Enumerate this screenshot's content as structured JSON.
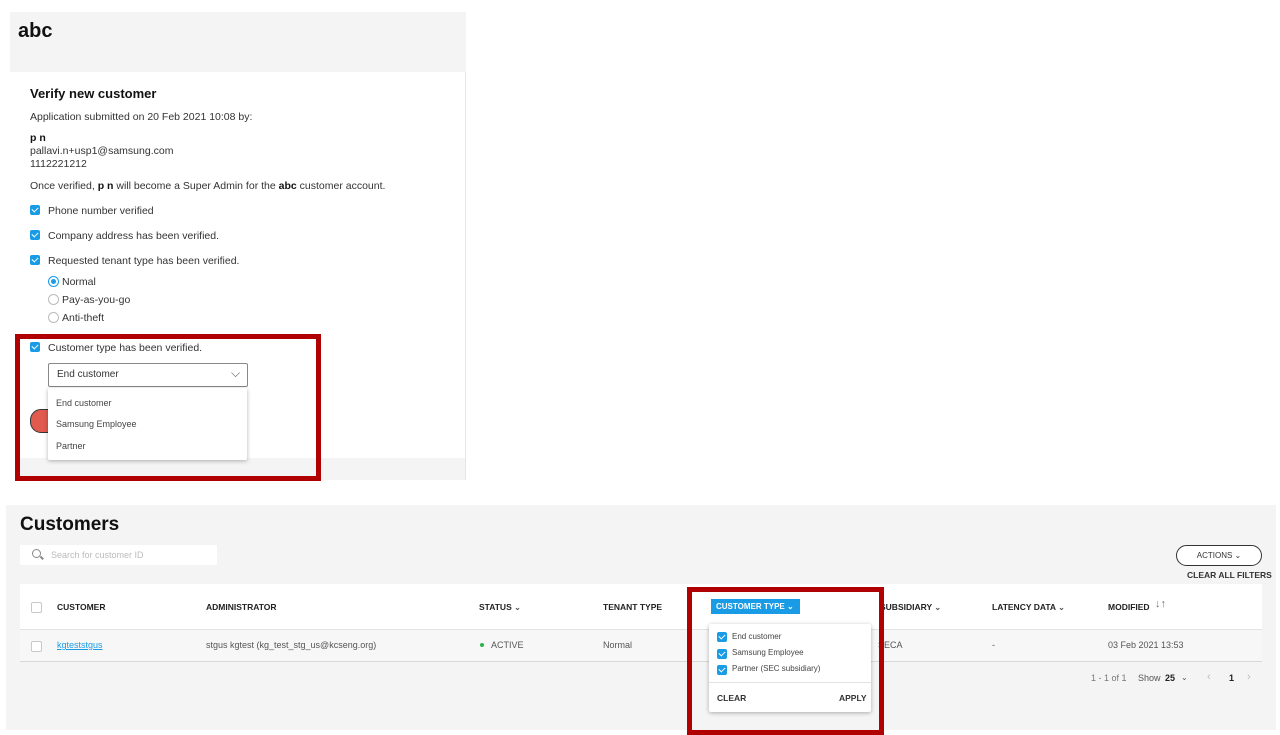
{
  "verify_panel": {
    "app_title": "abc",
    "title": "Verify new customer",
    "submitted_line": "Application submitted on 20 Feb 2021 10:08 by:",
    "applicant": {
      "name": "p n",
      "email": "pallavi.n+usp1@samsung.com",
      "phone": "1112221212"
    },
    "once_verified": {
      "prefix": "Once verified, ",
      "name": "p n",
      "middle": " will become a Super Admin for the ",
      "account": "abc",
      "suffix": " customer account."
    },
    "checks": {
      "phone": "Phone number verified",
      "address": "Company address has been verified.",
      "tenant": "Requested tenant type has been verified.",
      "customer_type": "Customer type has been verified."
    },
    "tenant_options": [
      "Normal",
      "Pay-as-you-go",
      "Anti-theft"
    ],
    "tenant_selected": "Normal",
    "customer_type_select": {
      "value": "End customer",
      "options": [
        "End customer",
        "Samsung Employee",
        "Partner"
      ]
    }
  },
  "customers": {
    "title": "Customers",
    "search_placeholder": "Search for customer ID",
    "actions_label": "ACTIONS",
    "clear_all_filters": "CLEAR ALL FILTERS",
    "columns": {
      "customer": "CUSTOMER",
      "administrator": "ADMINISTRATOR",
      "status": "STATUS",
      "tenant_type": "TENANT TYPE",
      "customer_type": "CUSTOMER TYPE",
      "subsidiary": "SUBSIDIARY",
      "latency_data": "LATENCY DATA",
      "modified": "MODIFIED"
    },
    "rows": [
      {
        "customer": "kgteststgus",
        "administrator": "stgus kgtest (kg_test_stg_us@kcseng.org)",
        "status": "ACTIVE",
        "tenant_type": "Normal",
        "subsidiary": "SECA",
        "latency_data": "-",
        "modified": "03 Feb 2021 13:53"
      }
    ],
    "customer_type_filter": {
      "options": [
        "End customer",
        "Samsung Employee",
        "Partner (SEC subsidiary)"
      ],
      "clear_label": "CLEAR",
      "apply_label": "APPLY"
    },
    "pagination": {
      "range": "1 - 1 of 1",
      "show_label": "Show",
      "page_size": "25",
      "current_page": "1"
    }
  },
  "colors": {
    "accent": "#1a9be6",
    "highlight": "#b00000",
    "status_active": "#2db34a"
  }
}
